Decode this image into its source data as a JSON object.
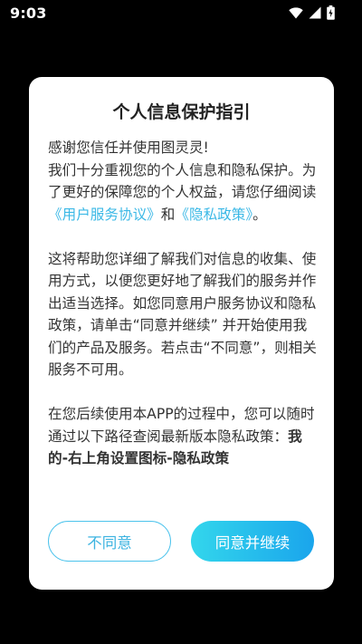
{
  "status_bar": {
    "time": "9:03",
    "icons": [
      "wifi-icon",
      "signal-icon",
      "battery-charging-icon"
    ]
  },
  "dialog": {
    "title": "个人信息保护指引",
    "p1": {
      "line1": "感谢您信任并使用图灵灵!",
      "text": "我们十分重视您的个人信息和隐私保护。为了更好的保障您的个人权益，请您仔细阅读",
      "link_agreement": "《用户服务协议》",
      "and": "和",
      "link_privacy": "《隐私政策》",
      "end": "。"
    },
    "p2": "这将帮助您详细了解我们对信息的收集、使用方式，以便您更好地了解我们的服务并作出适当选择。如您同意用户服务协议和隐私政策，请单击“同意并继续” 并开始使用我们的产品及服务。若点击“不同意”，则相关服务不可用。",
    "p3": {
      "text": "在您后续使用本APP的过程中，您可以随时通过以下路径查阅最新版本隐私政策：",
      "path": "我的-右上角设置图标-隐私政策"
    },
    "buttons": {
      "disagree": "不同意",
      "agree": "同意并继续"
    }
  },
  "colors": {
    "link": "#3bb8e6",
    "accent_start": "#33d6ec",
    "accent_end": "#1aa5ec",
    "backdrop": "#000000"
  }
}
